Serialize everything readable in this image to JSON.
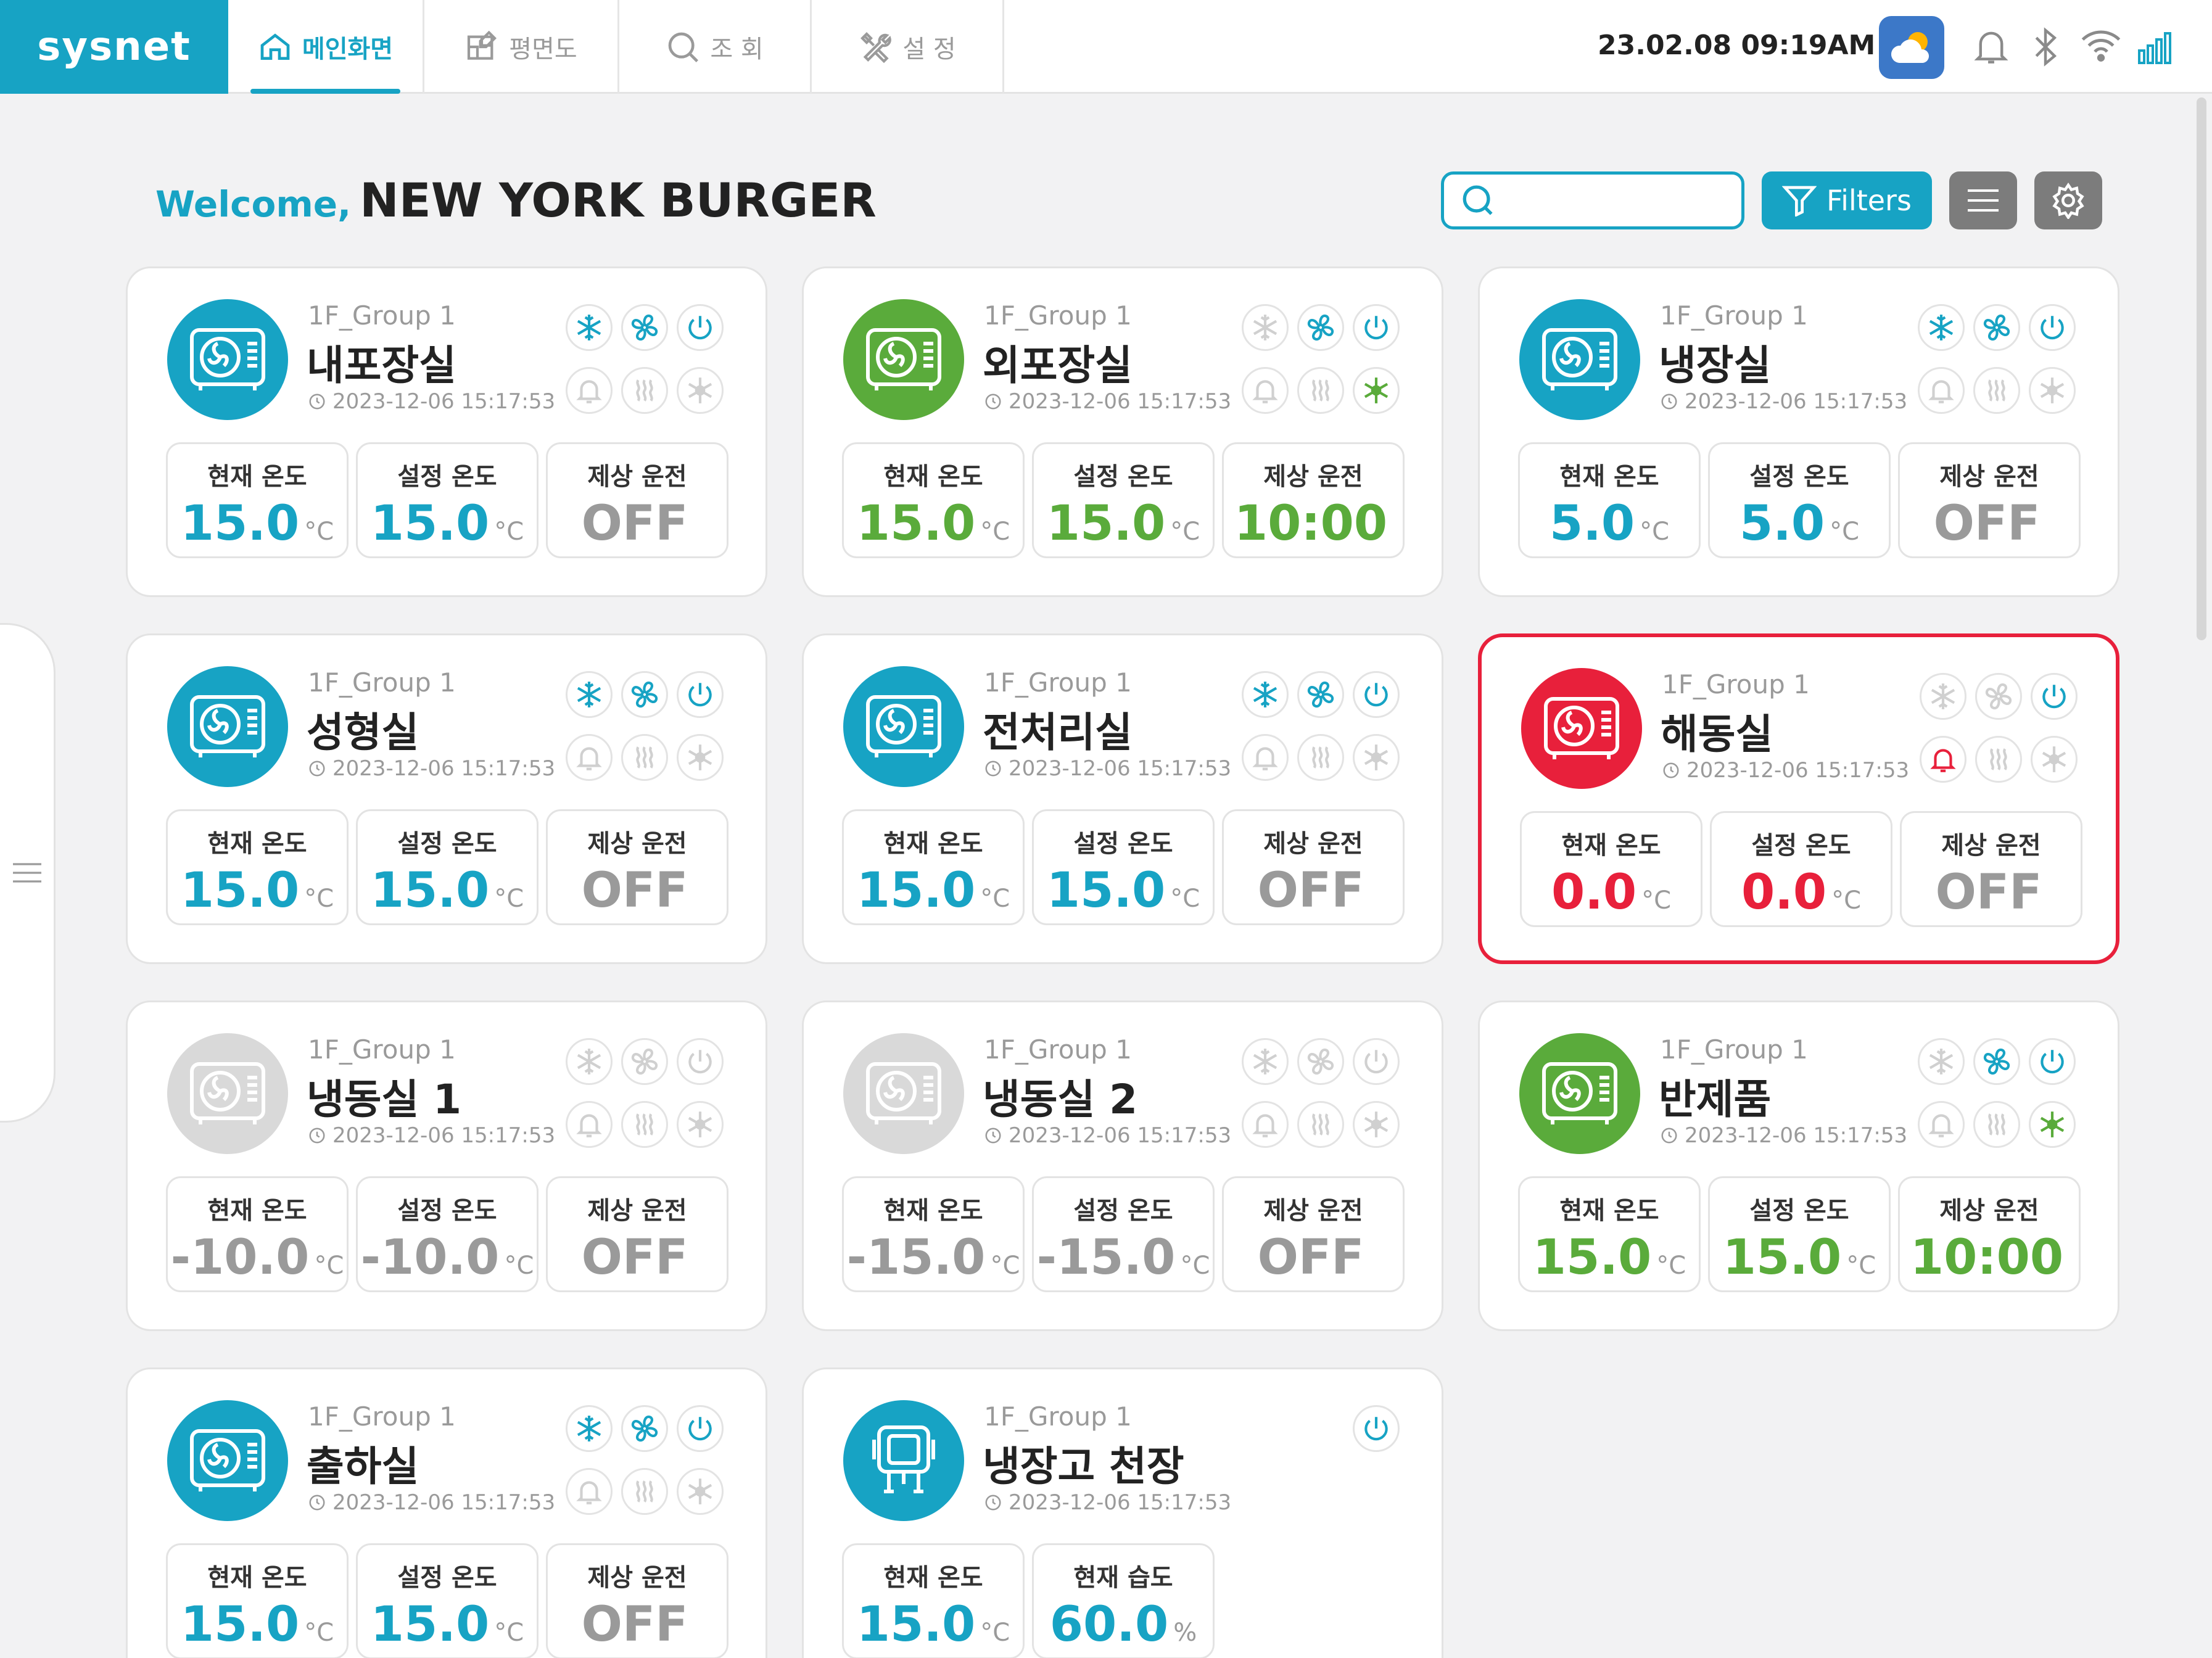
{
  "app": {
    "logo": "sysnet"
  },
  "nav": {
    "tabs": [
      {
        "label": "메인화면",
        "icon": "home-icon",
        "active": true
      },
      {
        "label": "평면도",
        "icon": "floorplan-icon",
        "active": false
      },
      {
        "label": "조 회",
        "icon": "search-icon",
        "active": false
      },
      {
        "label": "설 정",
        "icon": "tools-icon",
        "active": false
      }
    ]
  },
  "status": {
    "datetime": "23.02.08  09:19AM",
    "weather": "cloud-icon"
  },
  "header": {
    "welcome": "Welcome,",
    "store": "NEW YORK BURGER",
    "search_placeholder": "",
    "filters_label": "Filters"
  },
  "colors": {
    "accent": "#17a3c4",
    "green": "#5aab3b",
    "red": "#e8203b",
    "gray": "#d9d9d9",
    "off": "#9a9a9a"
  },
  "cards": [
    {
      "group": "1F_Group 1",
      "name": "내포장실",
      "time": "2023-12-06 15:17:53",
      "state": "blue",
      "labels": [
        "현재 온도",
        "설정 온도",
        "제상 운전"
      ],
      "values": [
        "15.0",
        "15.0",
        "OFF"
      ],
      "units": [
        "°C",
        "°C",
        ""
      ],
      "icons": {
        "snow": "on",
        "fan": "on",
        "power": "on",
        "bell": "off",
        "heat": "off",
        "defrost": "off"
      }
    },
    {
      "group": "1F_Group 1",
      "name": "외포장실",
      "time": "2023-12-06 15:17:53",
      "state": "green",
      "labels": [
        "현재 온도",
        "설정 온도",
        "제상 운전"
      ],
      "values": [
        "15.0",
        "15.0",
        "10:00"
      ],
      "units": [
        "°C",
        "°C",
        ""
      ],
      "icons": {
        "snow": "off",
        "fan": "on",
        "power": "on",
        "bell": "off",
        "heat": "off",
        "defrost": "green"
      }
    },
    {
      "group": "1F_Group 1",
      "name": "냉장실",
      "time": "2023-12-06 15:17:53",
      "state": "blue",
      "labels": [
        "현재 온도",
        "설정 온도",
        "제상 운전"
      ],
      "values": [
        "5.0",
        "5.0",
        "OFF"
      ],
      "units": [
        "°C",
        "°C",
        ""
      ],
      "icons": {
        "snow": "on",
        "fan": "on",
        "power": "on",
        "bell": "off",
        "heat": "off",
        "defrost": "off"
      }
    },
    {
      "group": "1F_Group 1",
      "name": "성형실",
      "time": "2023-12-06 15:17:53",
      "state": "blue",
      "labels": [
        "현재 온도",
        "설정 온도",
        "제상 운전"
      ],
      "values": [
        "15.0",
        "15.0",
        "OFF"
      ],
      "units": [
        "°C",
        "°C",
        ""
      ],
      "icons": {
        "snow": "on",
        "fan": "on",
        "power": "on",
        "bell": "off",
        "heat": "off",
        "defrost": "off"
      }
    },
    {
      "group": "1F_Group 1",
      "name": "전처리실",
      "time": "2023-12-06 15:17:53",
      "state": "blue",
      "labels": [
        "현재 온도",
        "설정 온도",
        "제상 운전"
      ],
      "values": [
        "15.0",
        "15.0",
        "OFF"
      ],
      "units": [
        "°C",
        "°C",
        ""
      ],
      "icons": {
        "snow": "on",
        "fan": "on",
        "power": "on",
        "bell": "off",
        "heat": "off",
        "defrost": "off"
      }
    },
    {
      "group": "1F_Group 1",
      "name": "해동실",
      "time": "2023-12-06 15:17:53",
      "state": "red",
      "labels": [
        "현재 온도",
        "설정 온도",
        "제상 운전"
      ],
      "values": [
        "0.0",
        "0.0",
        "OFF"
      ],
      "units": [
        "°C",
        "°C",
        ""
      ],
      "icons": {
        "snow": "off",
        "fan": "off",
        "power": "on",
        "bell": "alarm",
        "heat": "off",
        "defrost": "off"
      }
    },
    {
      "group": "1F_Group 1",
      "name": "냉동실 1",
      "time": "2023-12-06 15:17:53",
      "state": "gray",
      "labels": [
        "현재 온도",
        "설정 온도",
        "제상 운전"
      ],
      "values": [
        "-10.0",
        "-10.0",
        "OFF"
      ],
      "units": [
        "°C",
        "°C",
        ""
      ],
      "icons": {
        "snow": "off",
        "fan": "off",
        "power": "off",
        "bell": "off",
        "heat": "off",
        "defrost": "off"
      }
    },
    {
      "group": "1F_Group 1",
      "name": "냉동실 2",
      "time": "2023-12-06 15:17:53",
      "state": "gray",
      "labels": [
        "현재 온도",
        "설정 온도",
        "제상 운전"
      ],
      "values": [
        "-15.0",
        "-15.0",
        "OFF"
      ],
      "units": [
        "°C",
        "°C",
        ""
      ],
      "icons": {
        "snow": "off",
        "fan": "off",
        "power": "off",
        "bell": "off",
        "heat": "off",
        "defrost": "off"
      }
    },
    {
      "group": "1F_Group 1",
      "name": "반제품",
      "time": "2023-12-06 15:17:53",
      "state": "green",
      "labels": [
        "현재 온도",
        "설정 온도",
        "제상 운전"
      ],
      "values": [
        "15.0",
        "15.0",
        "10:00"
      ],
      "units": [
        "°C",
        "°C",
        ""
      ],
      "icons": {
        "snow": "off",
        "fan": "on",
        "power": "on",
        "bell": "off",
        "heat": "off",
        "defrost": "green"
      }
    },
    {
      "group": "1F_Group 1",
      "name": "출하실",
      "time": "2023-12-06 15:17:53",
      "state": "blue",
      "labels": [
        "현재 온도",
        "설정 온도",
        "제상 운전"
      ],
      "values": [
        "15.0",
        "15.0",
        "OFF"
      ],
      "units": [
        "°C",
        "°C",
        ""
      ],
      "icons": {
        "snow": "on",
        "fan": "on",
        "power": "on",
        "bell": "off",
        "heat": "off",
        "defrost": "off"
      }
    },
    {
      "group": "1F_Group 1",
      "name": "냉장고 천장",
      "time": "2023-12-06 15:17:53",
      "state": "blue",
      "device": "sensor",
      "labels": [
        "현재 온도",
        "현재 습도"
      ],
      "values": [
        "15.0",
        "60.0"
      ],
      "units": [
        "°C",
        "%"
      ],
      "icons": {
        "power": "on"
      }
    }
  ]
}
